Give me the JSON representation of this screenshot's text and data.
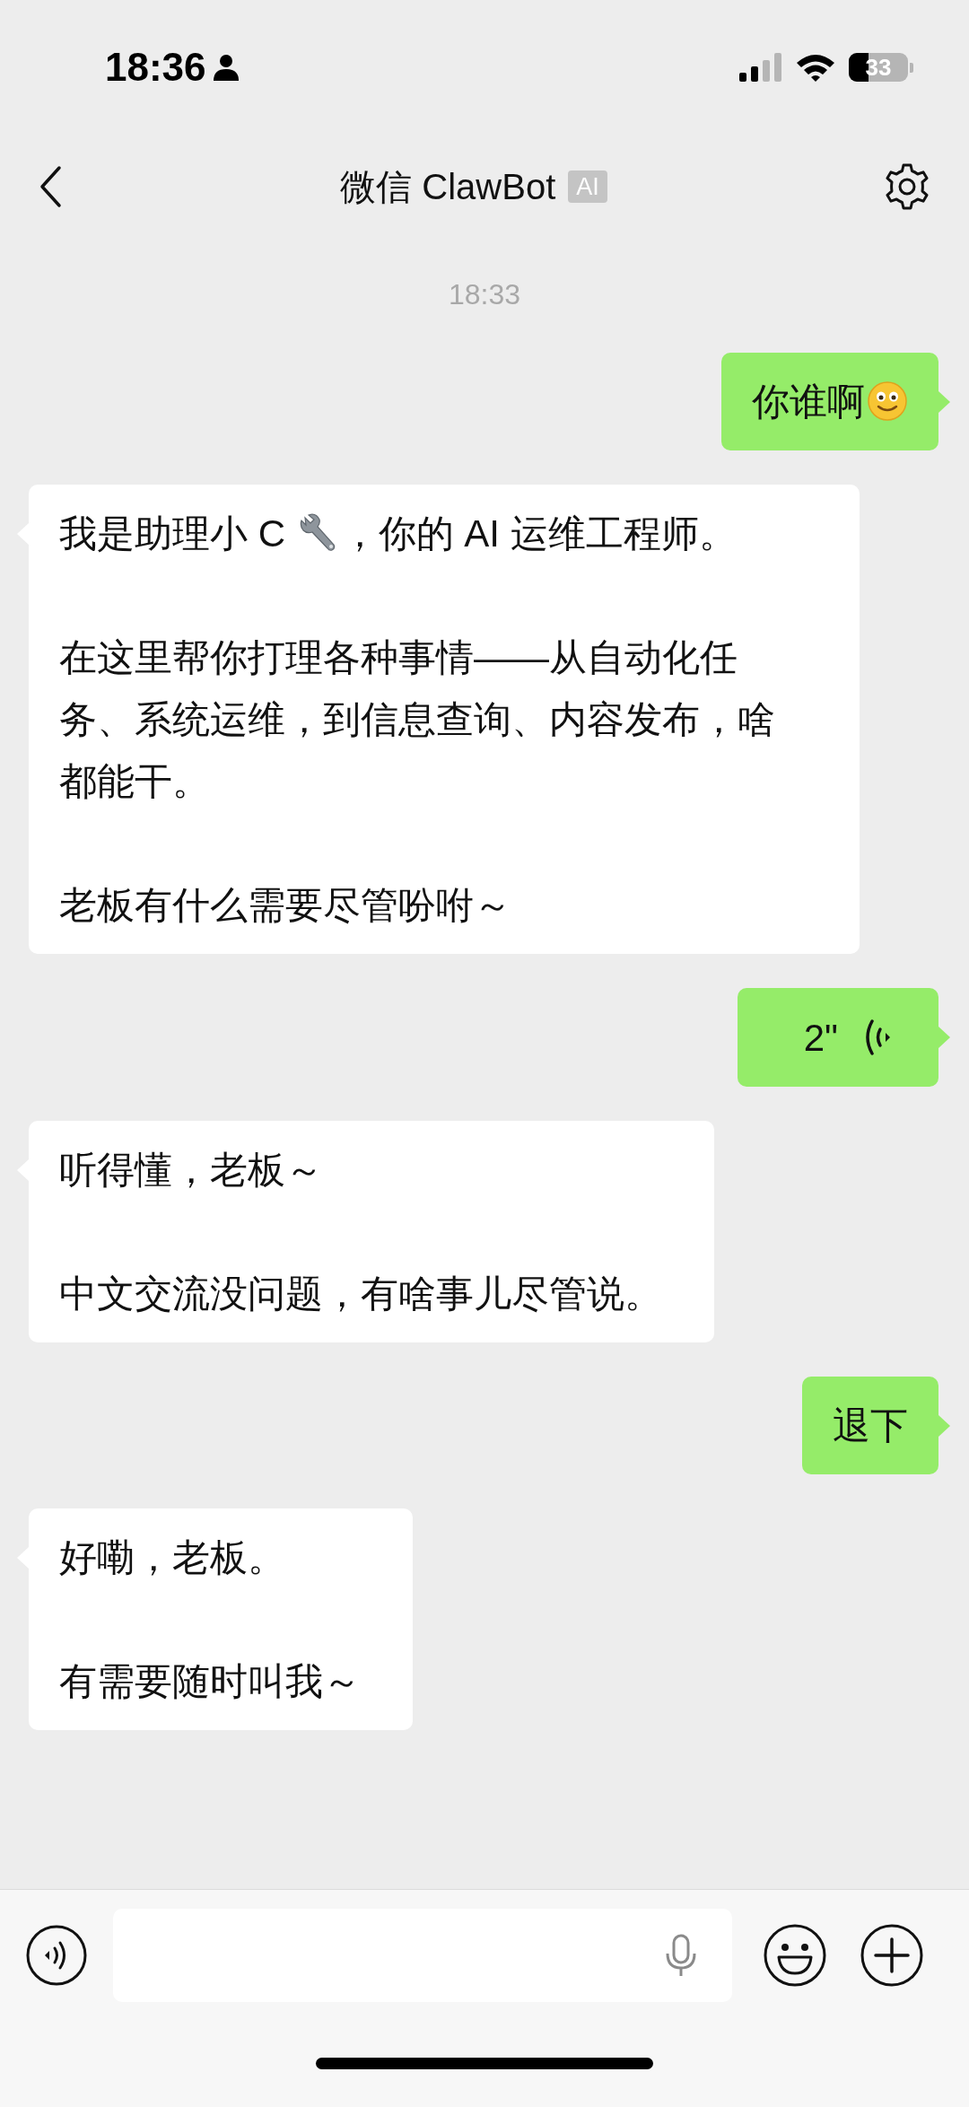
{
  "status_bar": {
    "time": "18:36",
    "battery": "33"
  },
  "header": {
    "title": "微信 ClawBot",
    "badge": "AI"
  },
  "timestamp": "18:33",
  "messages": [
    {
      "kind": "text",
      "outgoing": true,
      "paragraphs": [
        [
          {
            "kind": "text",
            "text": "你谁啊"
          },
          {
            "kind": "smiley"
          }
        ]
      ]
    },
    {
      "kind": "text",
      "outgoing": false,
      "paragraphs": [
        [
          {
            "kind": "text",
            "text": "我是助理小 C "
          },
          {
            "kind": "wrench"
          },
          {
            "kind": "text",
            "text": "，你的 AI 运维工程师。"
          }
        ],
        [
          {
            "kind": "text",
            "text": "在这里帮你打理各种事情——从自动化任务、系统运维，到信息查询、内容发布，啥都能干。"
          }
        ],
        [
          {
            "kind": "text",
            "text": "老板有什么需要尽管吩咐～"
          }
        ]
      ]
    },
    {
      "kind": "voice",
      "outgoing": true,
      "duration": "2\""
    },
    {
      "kind": "text",
      "outgoing": false,
      "paragraphs": [
        [
          {
            "kind": "text",
            "text": "听得懂，老板～"
          }
        ],
        [
          {
            "kind": "text",
            "text": "中文交流没问题，有啥事儿尽管说。"
          }
        ]
      ]
    },
    {
      "kind": "text",
      "outgoing": true,
      "paragraphs": [
        [
          {
            "kind": "text",
            "text": "退下"
          }
        ]
      ]
    },
    {
      "kind": "text",
      "outgoing": false,
      "paragraphs": [
        [
          {
            "kind": "text",
            "text": "好嘞，老板。"
          }
        ],
        [
          {
            "kind": "text",
            "text": "有需要随时叫我～"
          }
        ]
      ]
    }
  ]
}
